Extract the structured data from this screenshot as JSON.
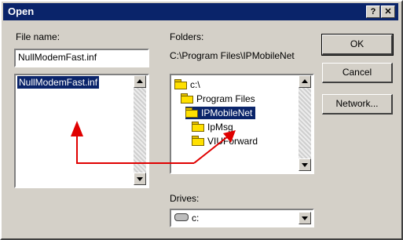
{
  "window": {
    "title": "Open",
    "help_label": "?",
    "close_label": "✕"
  },
  "file_name": {
    "label": "File name:",
    "value": "NullModemFast.inf"
  },
  "file_list": {
    "items": [
      "NullModemFast.inf"
    ],
    "selected": "NullModemFast.inf"
  },
  "folders": {
    "label": "Folders:",
    "current_path": "C:\\Program Files\\IPMobileNet",
    "items": [
      "c:\\",
      "Program Files",
      "IPMobileNet",
      "IpMsg",
      "VIUForward"
    ],
    "selected": "IPMobileNet"
  },
  "drives": {
    "label": "Drives:",
    "selected": "c:"
  },
  "buttons": {
    "ok": "OK",
    "cancel": "Cancel",
    "network": "Network..."
  },
  "colors": {
    "annotation": "#e00000",
    "selection": "#0a246a",
    "title_bar": "#0a246a",
    "face": "#d4d0c8"
  },
  "icons": [
    "folder-open-icon",
    "folder-closed-icon",
    "drive-icon",
    "scroll-up-icon",
    "scroll-down-icon",
    "dropdown-icon"
  ]
}
